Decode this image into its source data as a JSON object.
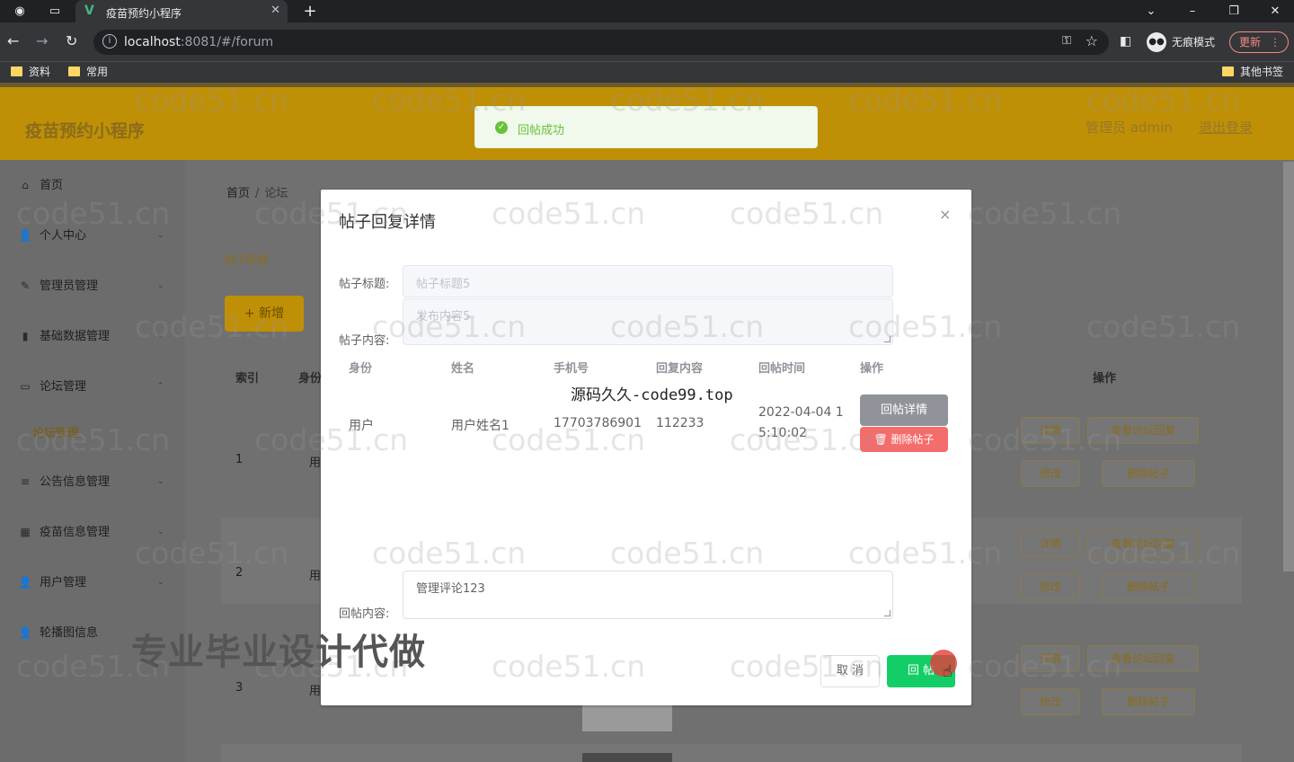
{
  "browser": {
    "tab_title": "疫苗预约小程序",
    "tab_close": "✕",
    "new_tab": "+",
    "url_host": "localhost",
    "url_rest": ":8081/#/forum",
    "incognito_label": "无痕模式",
    "update_label": "更新",
    "bookmarks": [
      "资料",
      "常用"
    ],
    "other_bookmarks": "其他书签"
  },
  "header": {
    "brand": "疫苗预约小程序",
    "user": "管理员 admin",
    "logout": "退出登录"
  },
  "sidebar": {
    "items": [
      {
        "label": "首页",
        "icon": "⌂"
      },
      {
        "label": "个人中心",
        "icon": "👤"
      },
      {
        "label": "管理员管理",
        "icon": "✎"
      },
      {
        "label": "基础数据管理",
        "icon": "▮"
      },
      {
        "label": "论坛管理",
        "icon": "▭"
      },
      {
        "label": "公告信息管理",
        "icon": "≡"
      },
      {
        "label": "疫苗信息管理",
        "icon": "▦"
      },
      {
        "label": "用户管理",
        "icon": "👤"
      },
      {
        "label": "轮播图信息",
        "icon": "👤"
      }
    ],
    "submenu_active": "论坛管理"
  },
  "main": {
    "breadcrumb_home": "首页",
    "breadcrumb_sep": "/",
    "breadcrumb_current": "论坛",
    "filter_label": "帖子标题",
    "add_button": "+ 新增",
    "table_headers": [
      "索引",
      "身份",
      "操作"
    ],
    "rows": [
      {
        "index": "1",
        "identity": "用",
        "op1": "详情",
        "op2": "查看论坛回复",
        "op3": "修改",
        "op4": "删除帖子"
      },
      {
        "index": "2",
        "identity": "用",
        "op1": "详情",
        "op2": "查看论坛回复",
        "op3": "修改",
        "op4": "删除帖子"
      },
      {
        "index": "3",
        "identity": "用",
        "op1": "详情",
        "op2": "查看论坛回复",
        "op3": "修改",
        "op4": "删除帖子"
      }
    ]
  },
  "dialog": {
    "title": "帖子回复详情",
    "close": "×",
    "title_label": "帖子标题:",
    "title_value": "帖子标题5",
    "content_label": "帖子内容:",
    "content_value": "发布内容5",
    "columns": [
      "身份",
      "姓名",
      "手机号",
      "回复内容",
      "回帖时间",
      "操作"
    ],
    "reply_row": {
      "identity": "用户",
      "name": "用户姓名1",
      "phone": "17703786901",
      "content": "112233",
      "time_line1": "2022-04-04 1",
      "time_line2": "5:10:02",
      "detail_button": "回帖详情",
      "delete_button": "删除帖子"
    },
    "reply_label": "回帖内容:",
    "reply_value": "管理评论123",
    "cancel_button": "取 消",
    "submit_button": "回 帖"
  },
  "toast": {
    "message": "回帖成功",
    "status_color": "#67c23a"
  },
  "overlays": {
    "site_watermark": "源码久久-code99.top",
    "caption": "专业毕业设计代做",
    "code_watermark": "code51.cn"
  },
  "colors": {
    "header": "#bf8f06",
    "success": "#13ce66",
    "danger": "#f56c6c",
    "info": "#909399"
  }
}
